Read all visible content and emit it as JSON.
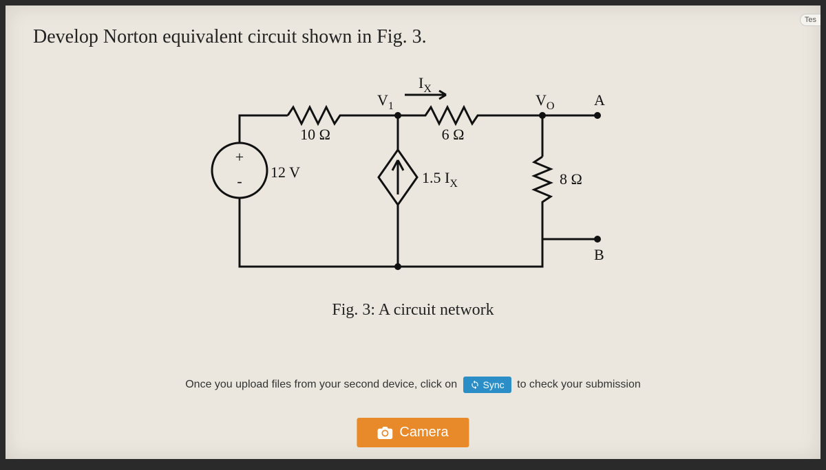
{
  "corner_tag": "Tes",
  "question": "Develop Norton equivalent circuit shown in Fig. 3.",
  "circuit": {
    "source_voltage": "12 V",
    "source_plus": "+",
    "source_minus": "-",
    "r1": "10 Ω",
    "r2": "6 Ω",
    "r_load": "8 Ω",
    "dep_source": "1.5 I",
    "dep_source_sub": "X",
    "ix": "I",
    "ix_sub": "X",
    "v1": "V",
    "v1_sub": "1",
    "vo": "V",
    "vo_sub": "O",
    "node_a": "A",
    "node_b": "B"
  },
  "caption": "Fig. 3: A circuit network",
  "instruction": {
    "before": "Once you upload files from your second device, click on",
    "sync": "Sync",
    "after": "to check your submission"
  },
  "buttons": {
    "camera": "Camera"
  }
}
